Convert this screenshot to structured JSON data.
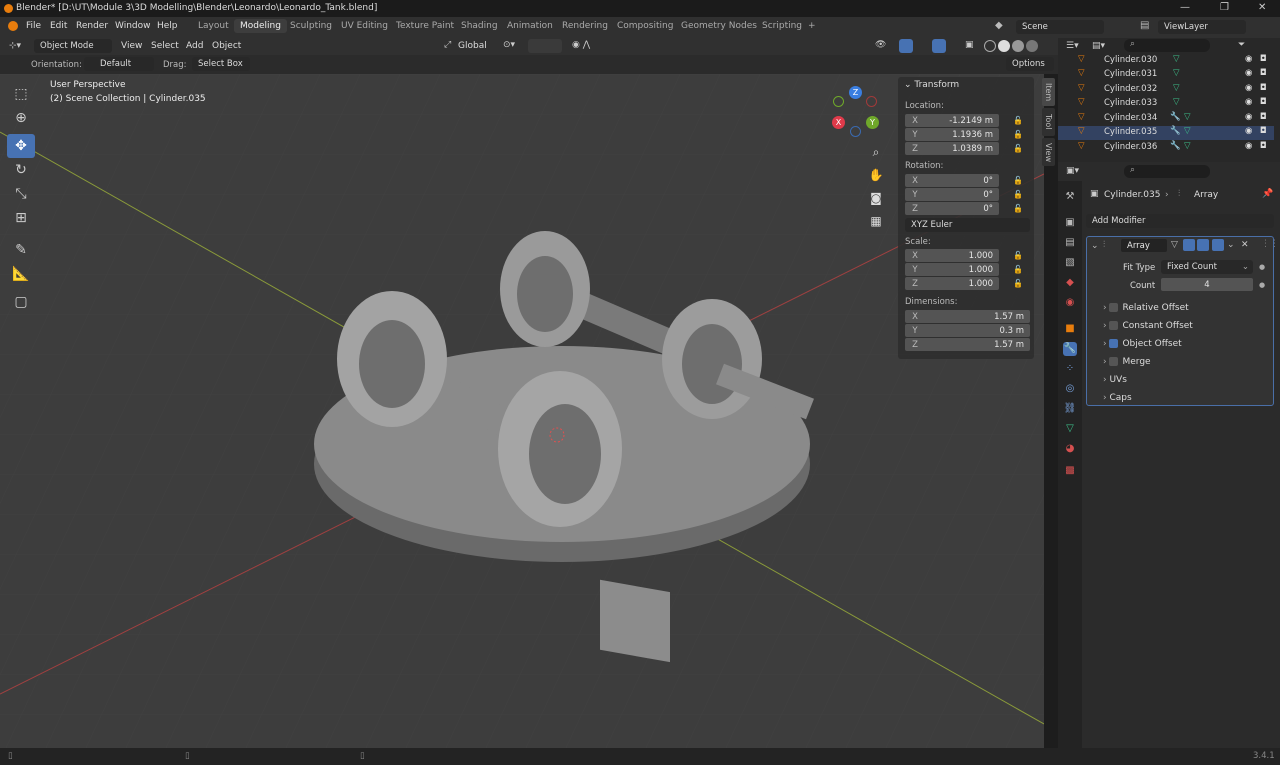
{
  "window": {
    "title": "Blender* [D:\\UT\\Module 3\\3D Modelling\\Blender\\Leonardo\\Leonardo_Tank.blend]",
    "minimize": "—",
    "maximize": "❐",
    "close": "✕"
  },
  "menus": [
    "File",
    "Edit",
    "Render",
    "Window",
    "Help"
  ],
  "workspaces": [
    "Layout",
    "Modeling",
    "Sculpting",
    "UV Editing",
    "Texture Paint",
    "Shading",
    "Animation",
    "Rendering",
    "Compositing",
    "Geometry Nodes",
    "Scripting",
    "+"
  ],
  "active_workspace": "Modeling",
  "scene": {
    "name": "Scene",
    "view_layer": "ViewLayer"
  },
  "header": {
    "mode": "Object Mode",
    "view": "View",
    "select": "Select",
    "add": "Add",
    "object": "Object",
    "transform_orientation": "Global"
  },
  "toolsettings": {
    "orientation_label": "Orientation:",
    "orientation_value": "Default",
    "drag_label": "Drag:",
    "drag_value": "Select Box",
    "options": "Options"
  },
  "viewport": {
    "perspective": "User Perspective",
    "collection": "(2) Scene Collection | Cylinder.035"
  },
  "npanel": {
    "section": "Transform",
    "location_label": "Location:",
    "location": {
      "x": "-1.2149 m",
      "y": "1.1936 m",
      "z": "1.0389 m"
    },
    "rotation_label": "Rotation:",
    "rotation": {
      "x": "0°",
      "y": "0°",
      "z": "0°"
    },
    "rotation_mode": "XYZ Euler",
    "scale_label": "Scale:",
    "scale": {
      "x": "1.000",
      "y": "1.000",
      "z": "1.000"
    },
    "dimensions_label": "Dimensions:",
    "dimensions": {
      "x": "1.57 m",
      "y": "0.3 m",
      "z": "1.57 m"
    },
    "axes": {
      "x": "X",
      "y": "Y",
      "z": "Z"
    },
    "tabs": [
      "Item",
      "Tool",
      "View"
    ]
  },
  "gizmo": {
    "x": "X",
    "y": "Y",
    "z": "Z"
  },
  "outliner": {
    "search_placeholder": "",
    "items": [
      "Cylinder.030",
      "Cylinder.031",
      "Cylinder.032",
      "Cylinder.033",
      "Cylinder.034",
      "Cylinder.035",
      "Cylinder.036"
    ]
  },
  "properties": {
    "object_name": "Cylinder.035",
    "modifier_crumb": "Array",
    "add_modifier": "Add Modifier",
    "modifier": {
      "name": "Array",
      "fit_type_label": "Fit Type",
      "fit_type": "Fixed Count",
      "count_label": "Count",
      "count": "4",
      "subpanels": [
        {
          "label": "Relative Offset",
          "checked": false
        },
        {
          "label": "Constant Offset",
          "checked": false
        },
        {
          "label": "Object Offset",
          "checked": true
        },
        {
          "label": "Merge",
          "checked": false
        }
      ],
      "uvs": "UVs",
      "caps": "Caps"
    }
  },
  "status": {
    "version": "3.4.1"
  },
  "colors": {
    "accent": "#4772b3",
    "x_axis": "#e03a4a",
    "y_axis": "#6fa82a",
    "z_axis": "#3a7ee0",
    "object_orange": "#e87d0d"
  }
}
